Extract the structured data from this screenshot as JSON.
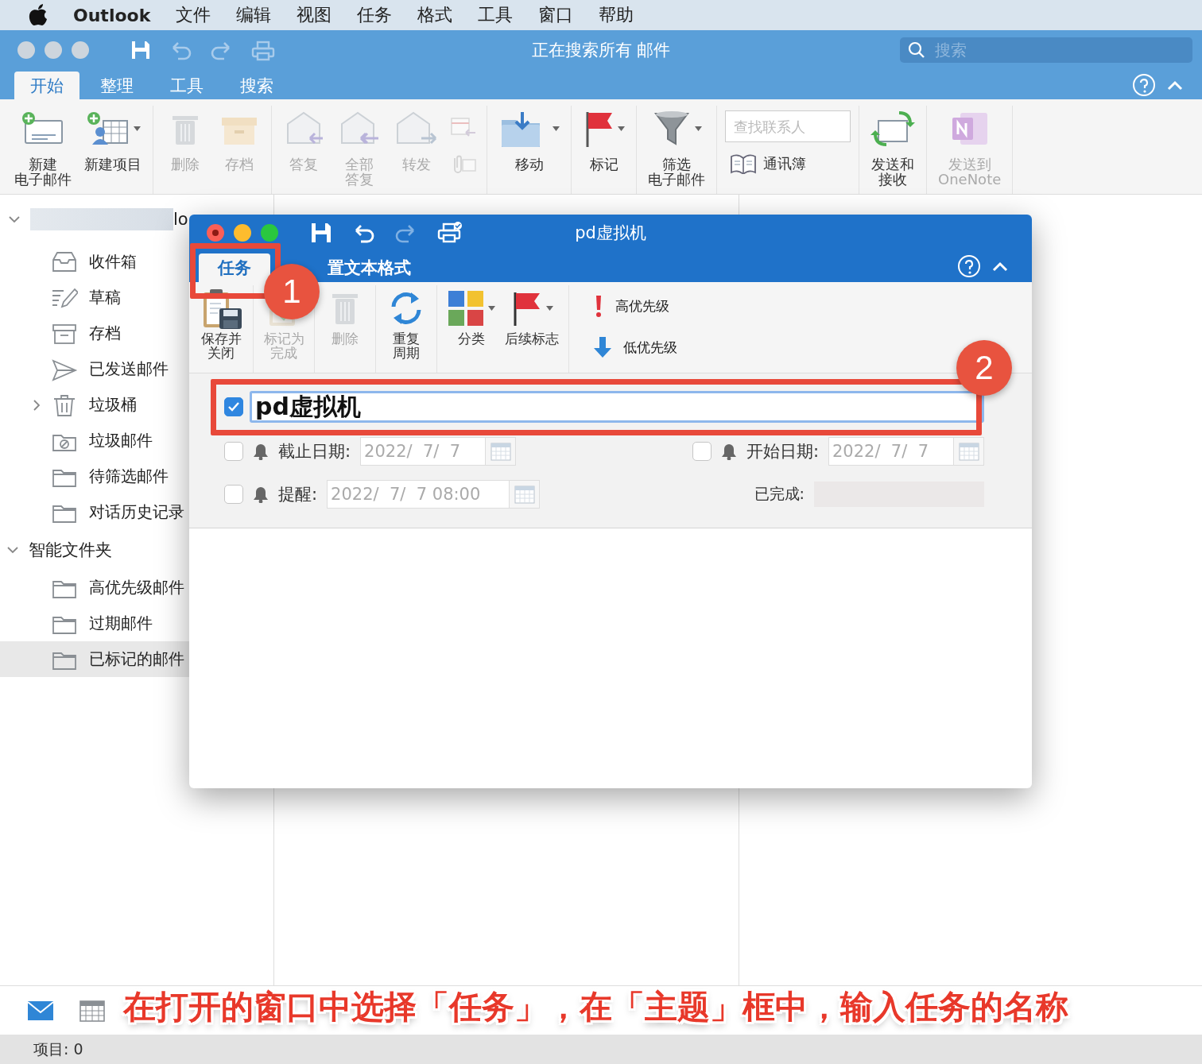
{
  "menu_bar": {
    "app_name": "Outlook",
    "items": [
      "文件",
      "编辑",
      "视图",
      "任务",
      "格式",
      "工具",
      "窗口",
      "帮助"
    ]
  },
  "main_window": {
    "title": "正在搜索所有 邮件",
    "search": {
      "placeholder": "搜索"
    },
    "tabs": [
      {
        "label": "开始",
        "selected": true
      },
      {
        "label": "整理",
        "selected": false
      },
      {
        "label": "工具",
        "selected": false
      },
      {
        "label": "搜索",
        "selected": false
      }
    ],
    "ribbon": [
      {
        "items": [
          {
            "kind": "large",
            "label": "新建电子邮件",
            "disabled": false,
            "menu": false
          },
          {
            "kind": "large",
            "label": "新建项目",
            "disabled": false,
            "menu": true
          }
        ]
      },
      {
        "items": [
          {
            "kind": "large",
            "label": "删除",
            "disabled": true,
            "menu": false
          },
          {
            "kind": "large",
            "label": "存档",
            "disabled": true,
            "menu": false
          }
        ]
      },
      {
        "items": [
          {
            "kind": "large",
            "label": "答复",
            "disabled": true,
            "menu": false
          },
          {
            "kind": "large",
            "label": "全部答复",
            "disabled": true,
            "menu": false
          },
          {
            "kind": "large",
            "label": "转发",
            "disabled": true,
            "menu": false
          },
          {
            "kind": "small-pair",
            "disabled": true
          }
        ]
      },
      {
        "items": [
          {
            "kind": "large",
            "label": "移动",
            "disabled": false,
            "menu": true
          }
        ]
      },
      {
        "items": [
          {
            "kind": "large",
            "label": "标记",
            "disabled": false,
            "menu": true
          }
        ]
      },
      {
        "items": [
          {
            "kind": "large",
            "label": "筛选电子邮件",
            "disabled": false,
            "menu": true
          }
        ]
      },
      {
        "items": [
          {
            "kind": "contacts",
            "placeholder": "查找联系人",
            "label": "通讯簿"
          }
        ]
      },
      {
        "items": [
          {
            "kind": "large",
            "label": "发送和接收",
            "disabled": false,
            "menu": false
          }
        ]
      },
      {
        "items": [
          {
            "kind": "large",
            "label": "发送到OneNote",
            "disabled": true,
            "menu": false
          }
        ]
      }
    ]
  },
  "sidebar": {
    "account": {
      "name": "lo",
      "expanded": true
    },
    "folders": [
      {
        "label": "收件箱",
        "selected": false
      },
      {
        "label": "草稿",
        "selected": false
      },
      {
        "label": "存档",
        "selected": false
      },
      {
        "label": "已发送邮件",
        "selected": false
      },
      {
        "label": "垃圾桶",
        "selected": false,
        "expanded": false
      },
      {
        "label": "垃圾邮件",
        "selected": false
      },
      {
        "label": "待筛选邮件",
        "selected": false
      },
      {
        "label": "对话历史记录",
        "selected": false
      }
    ],
    "smart_folders": {
      "label": "智能文件夹",
      "expanded": true,
      "children": [
        {
          "label": "高优先级邮件",
          "selected": false
        },
        {
          "label": "过期邮件",
          "selected": false
        },
        {
          "label": "已标记的邮件",
          "selected": true
        }
      ]
    }
  },
  "nav": [
    {
      "selected": true
    },
    {
      "selected": false
    }
  ],
  "status_bar": "项目: 0",
  "task_window": {
    "title": "pd虚拟机",
    "tabs": [
      {
        "label": "任务",
        "selected": true
      },
      {
        "label": "置文本格式",
        "selected": false
      }
    ],
    "ribbon": [
      {
        "label": "保存并关闭",
        "disabled": false,
        "menu": false
      },
      {
        "label": "标记为完成",
        "disabled": true,
        "menu": false
      },
      {
        "label": "删除",
        "disabled": true,
        "menu": false
      },
      {
        "label": "重复周期",
        "disabled": false,
        "menu": false
      },
      {
        "label": "分类",
        "disabled": false,
        "menu": true
      },
      {
        "label": "后续标志",
        "disabled": false,
        "menu": true
      }
    ],
    "priority": [
      {
        "label": "高优先级"
      },
      {
        "label": "低优先级"
      }
    ],
    "subject": {
      "value": "pd虚拟机",
      "checked": true
    },
    "due": {
      "label": "截止日期:",
      "checked": false,
      "value": "2022/  7/  7"
    },
    "start": {
      "label": "开始日期:",
      "checked": false,
      "value": "2022/  7/  7"
    },
    "reminder": {
      "label": "提醒:",
      "checked": false,
      "value": "2022/  7/  7 08:00"
    },
    "completed": {
      "label": "已完成:"
    }
  },
  "annotations": {
    "badges": [
      "1",
      "2"
    ],
    "caption": "在打开的窗口中选择「任务」，在「主题」框中，输入任务的名称"
  }
}
